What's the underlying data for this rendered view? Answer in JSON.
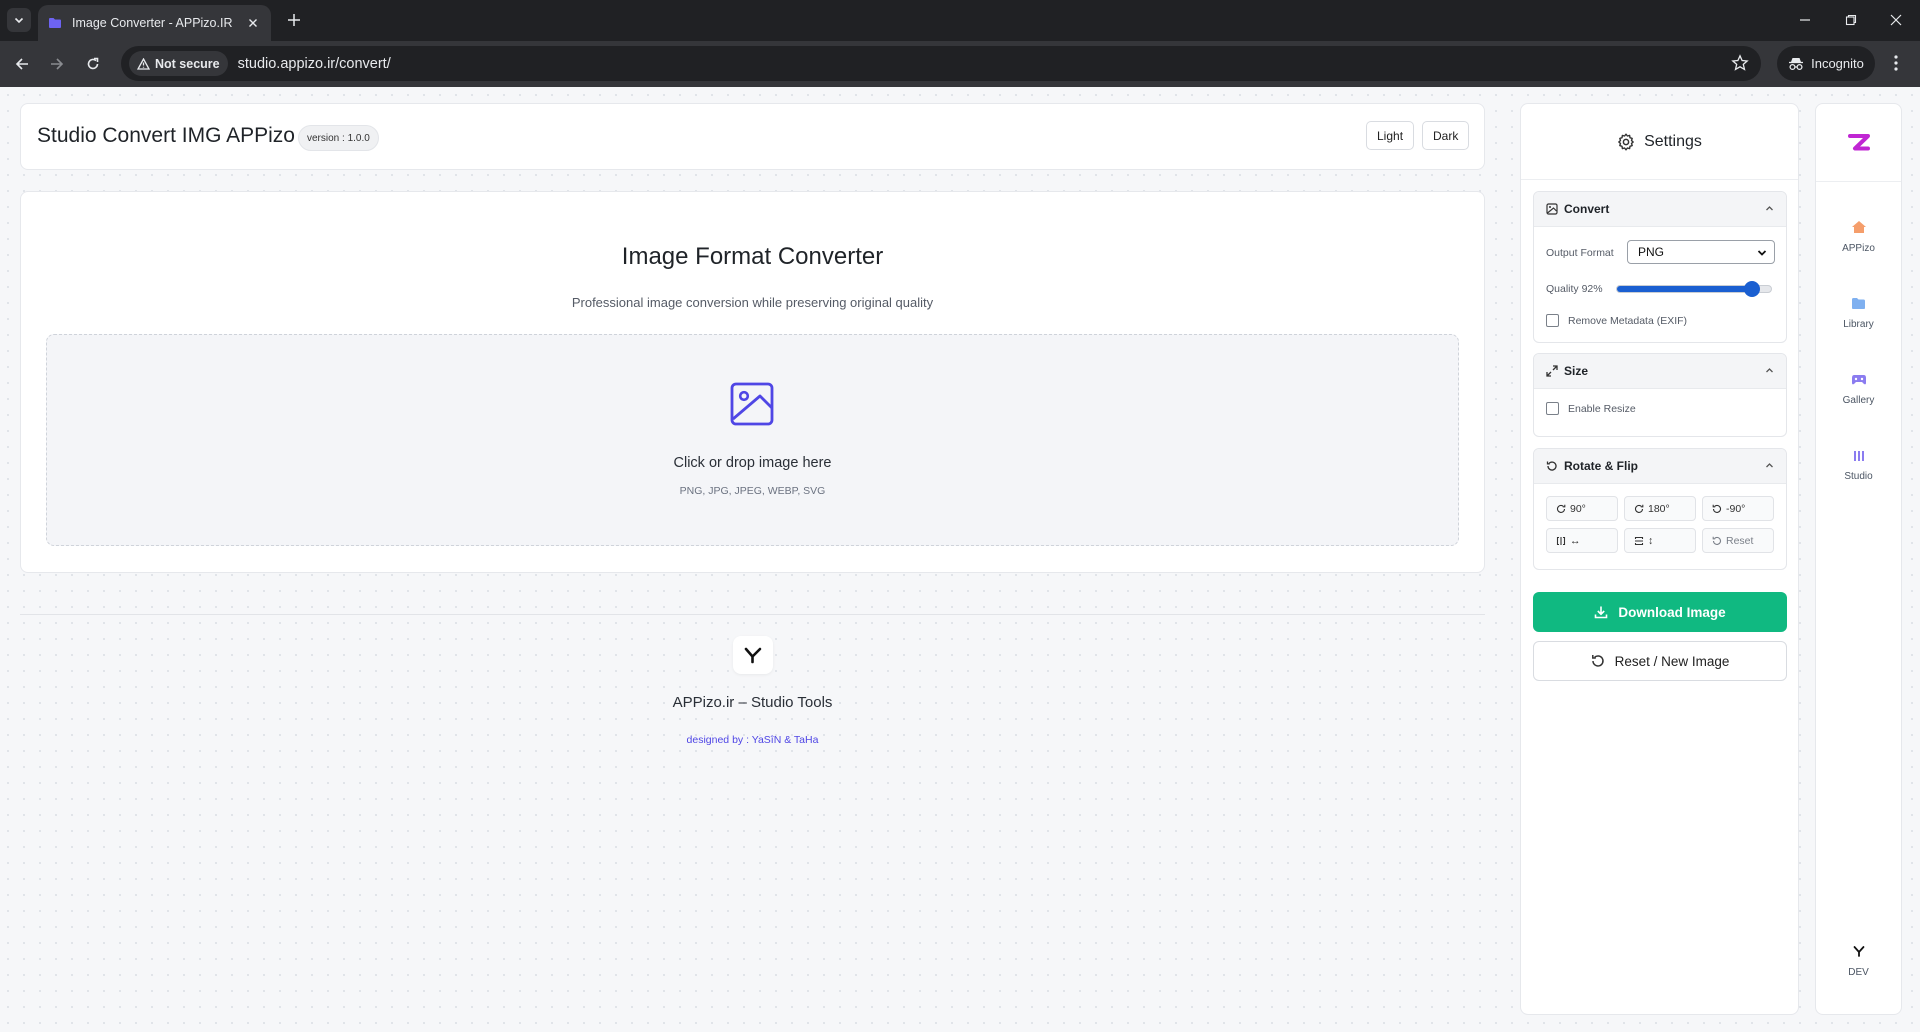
{
  "browser": {
    "tab_title": "Image Converter - APPizo.IR",
    "security_label": "Not secure",
    "url": "studio.appizo.ir/convert/",
    "incognito_label": "Incognito"
  },
  "header": {
    "title": "Studio Convert IMG APPizo",
    "version": "version : 1.0.0",
    "theme_light": "Light",
    "theme_dark": "Dark"
  },
  "main": {
    "title": "Image Format Converter",
    "subtitle": "Professional image conversion while preserving original quality",
    "dropzone_text": "Click or drop image here",
    "dropzone_formats": "PNG, JPG, JPEG, WEBP, SVG"
  },
  "footer": {
    "brand": "APPizo.ir – Studio Tools",
    "credit": "designed by : YaSîN & TaHa"
  },
  "settings": {
    "title": "Settings",
    "convert": {
      "heading": "Convert",
      "output_format_label": "Output Format",
      "output_format_value": "PNG",
      "quality_label": "Quality 92%",
      "quality_value": 0.92,
      "remove_metadata_label": "Remove Metadata (EXIF)"
    },
    "size": {
      "heading": "Size",
      "enable_resize_label": "Enable Resize"
    },
    "rotate": {
      "heading": "Rotate & Flip",
      "rot_90": "90°",
      "rot_180": "180°",
      "rot_neg90": "-90°",
      "flip_h": "↔",
      "flip_v": "↕",
      "reset": "Reset"
    },
    "download_label": "Download Image",
    "reset_label": "Reset / New Image"
  },
  "rail": {
    "items": [
      {
        "label": "APPizo"
      },
      {
        "label": "Library"
      },
      {
        "label": "Gallery"
      },
      {
        "label": "Studio"
      },
      {
        "label": "DEV"
      }
    ]
  },
  "colors": {
    "accent": "#4f46e5",
    "download": "#10b981",
    "slider": "#1a5fd1"
  }
}
